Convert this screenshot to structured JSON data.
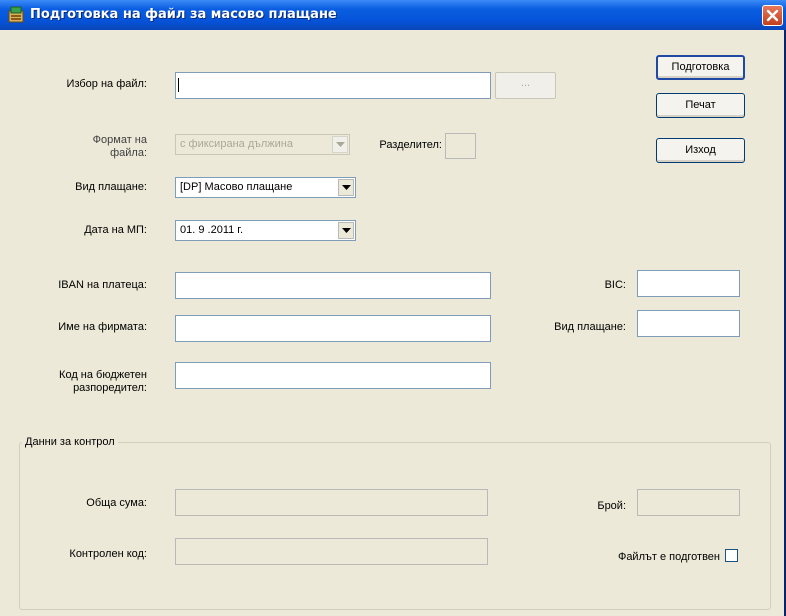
{
  "window": {
    "title": "Подготовка на файл за масово плащане"
  },
  "buttons": {
    "prepare": "Подготовка",
    "print": "Печат",
    "exit": "Изход",
    "browse": "..."
  },
  "form": {
    "file_select_label": "Избор на файл:",
    "file_select_value": "",
    "file_format_label_line1": "Формат на",
    "file_format_label_line2": "файла:",
    "file_format_value": "с фиксирана дължина",
    "separator_label": "Разделител:",
    "separator_value": "",
    "payment_type_label": "Вид плащане:",
    "payment_type_value": "[DP] Масово плащане",
    "date_label": "Дата на МП:",
    "date_value": "01. 9 .2011 г.",
    "iban_label": "IBAN на платеца:",
    "iban_value": "",
    "company_name_label": "Име на фирмата:",
    "company_name_value": "",
    "budget_code_label_line1": "Код на бюджетен",
    "budget_code_label_line2": "разпоредител:",
    "budget_code_value": "",
    "bic_label": "BIC:",
    "bic_value": "",
    "payment_kind_label": "Вид плащане:",
    "payment_kind_value": ""
  },
  "control": {
    "group_title": "Данни за контрол",
    "total_sum_label": "Обща сума:",
    "total_sum_value": "",
    "count_label": "Брой:",
    "count_value": "",
    "control_code_label": "Контролен код:",
    "control_code_value": "",
    "file_ready_label": "Файлът е подготвен",
    "file_ready_checked": false
  },
  "colors": {
    "titlebar": "#0553d9",
    "window_bg": "#ece9d8",
    "close_button": "#c2401c",
    "field_border": "#7f9db9"
  },
  "icons": {
    "title": "app-icon",
    "close": "close-icon",
    "dropdown": "chevron-down-icon"
  }
}
